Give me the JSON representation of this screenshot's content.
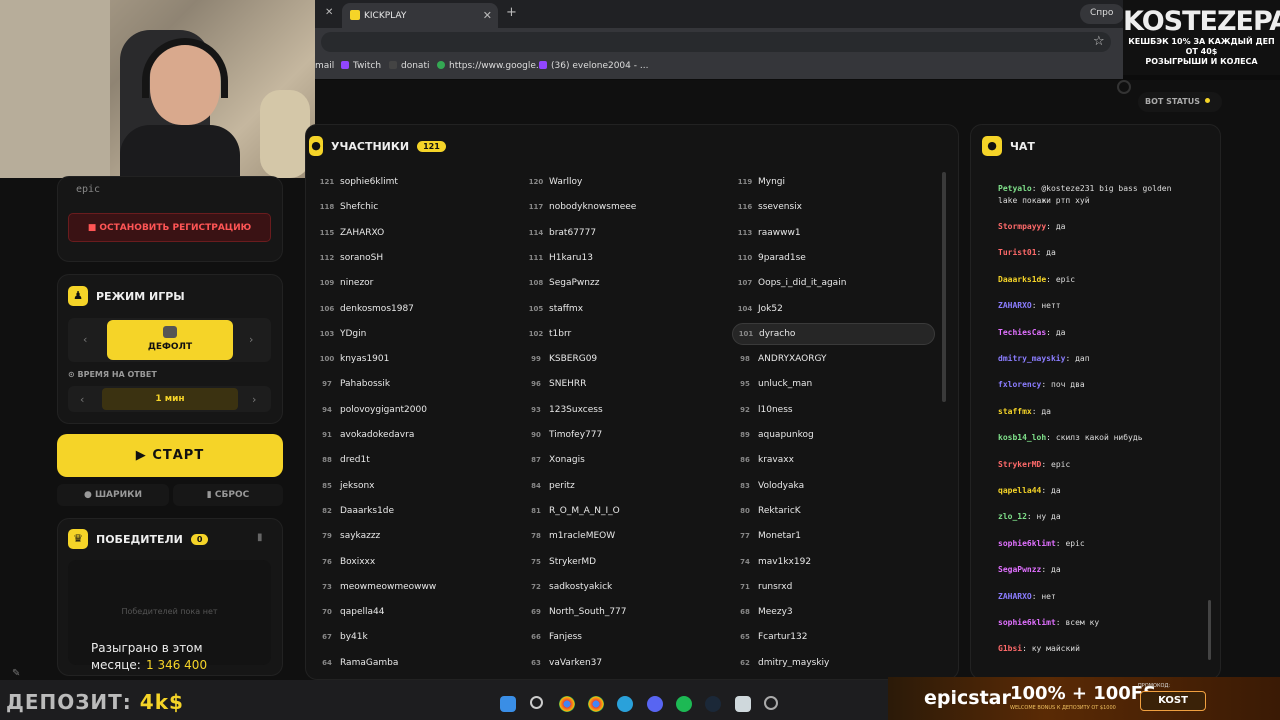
{
  "browser": {
    "tab_title": "KICKPLAY",
    "side_tab": "Спро",
    "bookmarks": [
      "mail",
      "Twitch",
      "donati",
      "https://www.google...",
      "(36) evelone2004 - ..."
    ]
  },
  "overlay": {
    "brand": "KOSTEZEPAY",
    "promo_line1": "КЕШБЭК 10% ЗА КАЖДЫЙ ДЕП ОТ 40$",
    "promo_line2": "РОЗЫГРЫШИ И КОЛЕСА",
    "deposit_label": "ДЕПОЗИТ:",
    "deposit_value": "4k$",
    "ad_brand": "epicstar",
    "ad_bonus": "100% + 100FS",
    "ad_small": "WELCOME BONUS К ДЕПОЗИТУ ОТ $1000",
    "ad_promo_label": "ПРОМОКОД:",
    "ad_promo_code": "KOST"
  },
  "left": {
    "keyword": "epic",
    "stop_registration": "■ ОСТАНОВИТЬ РЕГИСТРАЦИЮ",
    "mode_title": "РЕЖИМ ИГРЫ",
    "mode_value": "ДЕФОЛТ",
    "time_label": "⊙ ВРЕМЯ НА ОТВЕТ",
    "time_value": "1   мин",
    "start": "▶  СТАРТ",
    "balls": "● ШАРИКИ",
    "reset": "▮ СБРОС",
    "winners_title": "ПОБЕДИТЕЛИ",
    "winners_count": "0",
    "no_winners": "Победителей пока нет",
    "played_label": "Разыграно в этом месяце:",
    "played_value": "1 346 400"
  },
  "participants": {
    "title": "УЧАСТНИКИ",
    "count": "121",
    "highlighted": "101",
    "items": [
      [
        "121",
        "sophie6klimt"
      ],
      [
        "120",
        "Warlloy"
      ],
      [
        "119",
        "Myngi"
      ],
      [
        "118",
        "Shefchic"
      ],
      [
        "117",
        "nobodyknowsmeee"
      ],
      [
        "116",
        "ssevensix"
      ],
      [
        "115",
        "ZAHARXO"
      ],
      [
        "114",
        "brat67777"
      ],
      [
        "113",
        "raawww1"
      ],
      [
        "112",
        "soranoSH"
      ],
      [
        "111",
        "H1karu13"
      ],
      [
        "110",
        "9parad1se"
      ],
      [
        "109",
        "ninezor"
      ],
      [
        "108",
        "SegaPwnzz"
      ],
      [
        "107",
        "Oops_i_did_it_again"
      ],
      [
        "106",
        "denkosmos1987"
      ],
      [
        "105",
        "staffmx"
      ],
      [
        "104",
        "Jok52"
      ],
      [
        "103",
        "YDgin"
      ],
      [
        "102",
        "t1brr"
      ],
      [
        "101",
        "dyracho"
      ],
      [
        "100",
        "knyas1901"
      ],
      [
        "99",
        "KSBERG09"
      ],
      [
        "98",
        "ANDRYXAORGY"
      ],
      [
        "97",
        "Pahabossik"
      ],
      [
        "96",
        "SNEHRR"
      ],
      [
        "95",
        "unluck_man"
      ],
      [
        "94",
        "polovoygigant2000"
      ],
      [
        "93",
        "123Suxcess"
      ],
      [
        "92",
        "l10ness"
      ],
      [
        "91",
        "avokadokedavra"
      ],
      [
        "90",
        "Timofey777"
      ],
      [
        "89",
        "aquapunkog"
      ],
      [
        "88",
        "dred1t"
      ],
      [
        "87",
        "Xonagis"
      ],
      [
        "86",
        "kravaxx"
      ],
      [
        "85",
        "jeksonx"
      ],
      [
        "84",
        "peritz"
      ],
      [
        "83",
        "Volodyaka"
      ],
      [
        "82",
        "Daaarks1de"
      ],
      [
        "81",
        "R_O_M_A_N_I_O"
      ],
      [
        "80",
        "RektaricK"
      ],
      [
        "79",
        "saykazzz"
      ],
      [
        "78",
        "m1racleMEOW"
      ],
      [
        "77",
        "Monetar1"
      ],
      [
        "76",
        "Boxixxx"
      ],
      [
        "75",
        "StrykerMD"
      ],
      [
        "74",
        "mav1kx192"
      ],
      [
        "73",
        "meowmeowmeowww"
      ],
      [
        "72",
        "sadkostyakick"
      ],
      [
        "71",
        "runsrxd"
      ],
      [
        "70",
        "qapella44"
      ],
      [
        "69",
        "North_South_777"
      ],
      [
        "68",
        "Meezy3"
      ],
      [
        "67",
        "by41k"
      ],
      [
        "66",
        "Fanjess"
      ],
      [
        "65",
        "Fcartur132"
      ],
      [
        "64",
        "RamaGamba"
      ],
      [
        "63",
        "vaVarken37"
      ],
      [
        "62",
        "dmitry_mayskiy"
      ]
    ]
  },
  "chat": {
    "title": "ЧАТ",
    "bot_status": "BOT STATUS",
    "messages": [
      {
        "user": "Petyalo",
        "text": "@kosteze231 big bass golden lake покажи ртп хуй",
        "color": "#7fe08a"
      },
      {
        "user": "Stormpayyy",
        "text": "да",
        "color": "#ff6a6a"
      },
      {
        "user": "Turist01",
        "text": "да",
        "color": "#ff6a6a"
      },
      {
        "user": "Daaarks1de",
        "text": "epic",
        "color": "#f5d428"
      },
      {
        "user": "ZAHARXO",
        "text": "нетт",
        "color": "#8b7dff"
      },
      {
        "user": "TechiesCas",
        "text": "да",
        "color": "#e070ff"
      },
      {
        "user": "dmitry_mayskiy",
        "text": "дап",
        "color": "#8b7dff"
      },
      {
        "user": "fxlorency",
        "text": "поч два",
        "color": "#8b7dff"
      },
      {
        "user": "staffmx",
        "text": "да",
        "color": "#f5d428"
      },
      {
        "user": "kosb14_loh",
        "text": "скилз какой нибудь",
        "color": "#7fe08a"
      },
      {
        "user": "StrykerMD",
        "text": "epic",
        "color": "#ff6a6a"
      },
      {
        "user": "qapella44",
        "text": "да",
        "color": "#f5d428"
      },
      {
        "user": "zlo_12",
        "text": "ну да",
        "color": "#7fe08a"
      },
      {
        "user": "sophie6klimt",
        "text": "epic",
        "color": "#e070ff"
      },
      {
        "user": "SegaPwnzz",
        "text": "да",
        "color": "#e070ff"
      },
      {
        "user": "ZAHARXO",
        "text": "нет",
        "color": "#8b7dff"
      },
      {
        "user": "sophie6klimt",
        "text": "всем ку",
        "color": "#e070ff"
      },
      {
        "user": "G1bsi",
        "text": "ку майский",
        "color": "#ff6a6a"
      }
    ]
  }
}
